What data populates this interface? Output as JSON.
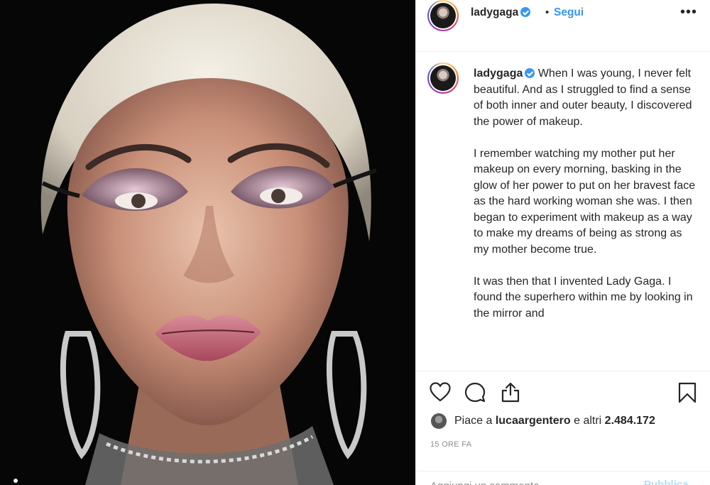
{
  "post": {
    "username": "ladygaga",
    "separator": "•",
    "follow_label": "Segui",
    "more_icon": "more-horizontal-icon",
    "caption_paragraphs": [
      "When I was young, I never felt beautiful. And as I struggled to find a sense of both inner and outer beauty, I discovered the power of makeup.",
      "I remember watching my mother put her makeup on every morning, basking in the glow of her power to put on her bravest face as the hard working woman she was. I then began to experiment with makeup as a way to make my dreams of being as strong as my mother become true.",
      "It was then that I invented Lady Gaga. I found the superhero within me by looking in the mirror and"
    ],
    "likes_prefix": "Piace a",
    "likes_user": "lucaargentero",
    "likes_suffix": "e altri",
    "likes_count": "2.484.172",
    "timestamp": "15 ORE FA",
    "comment_placeholder": "Aggiungi un commento...",
    "publish_label": "Pubblica"
  },
  "colors": {
    "accent": "#3897f0",
    "publish_disabled": "#b2dffc",
    "muted": "#8e8e8e",
    "text": "#262626"
  }
}
